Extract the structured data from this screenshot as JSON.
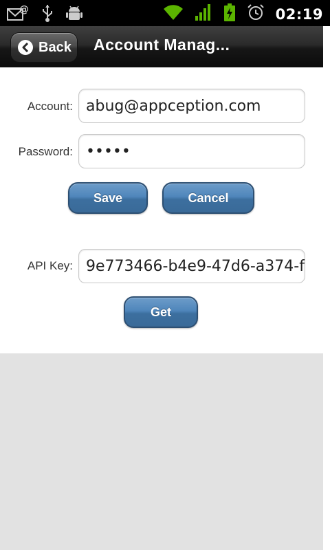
{
  "status_bar": {
    "time": "02:19",
    "icons": [
      "email-icon",
      "usb-icon",
      "android-debug-icon",
      "wifi-icon",
      "signal-icon",
      "battery-charging-icon",
      "alarm-icon"
    ]
  },
  "header": {
    "back_label": "Back",
    "title": "Account Manag..."
  },
  "form": {
    "account_label": "Account:",
    "account_value": "abug@appception.com",
    "password_label": "Password:",
    "password_value": "•••••",
    "save_label": "Save",
    "cancel_label": "Cancel",
    "api_key_label": "API Key:",
    "api_key_value": "9e773466-b4e9-47d6-a374-f",
    "get_label": "Get"
  },
  "colors": {
    "button_blue": "#4f86bb",
    "title_bar": "#1c1c1c",
    "empty_area": "#e2e2e2"
  }
}
